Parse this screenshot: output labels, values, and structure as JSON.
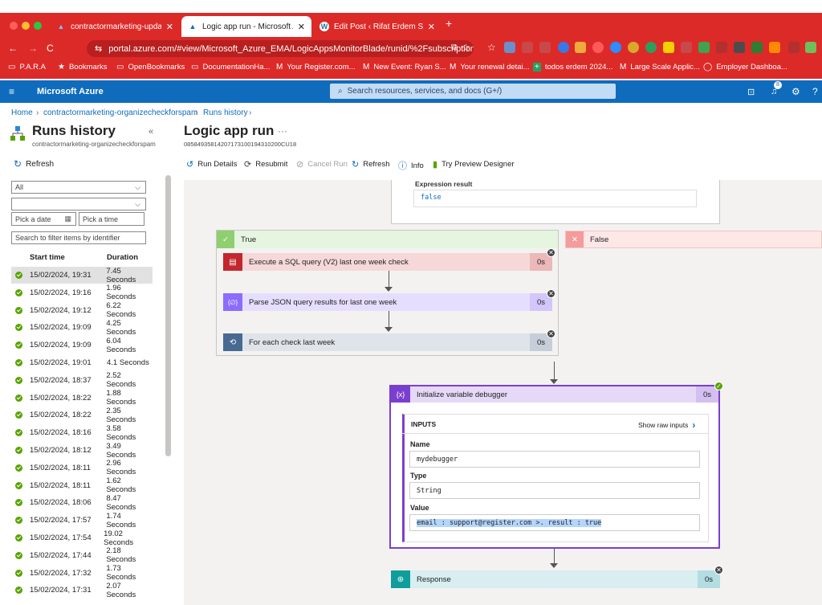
{
  "browser": {
    "tabs": [
      {
        "title": "contractormarketing-updated",
        "icon": "azure-icon"
      },
      {
        "title": "Logic app run - Microsoft Azu",
        "icon": "azure-icon"
      },
      {
        "title": "Edit Post ‹ Rifat Erdem Sahin",
        "icon": "wordpress-icon"
      }
    ],
    "url": "portal.azure.com/#view/Microsoft_Azure_EMA/LogicAppsMonitorBlade/runid/%2Fsubscriptions...",
    "bookmarks": [
      {
        "label": "P.A.R.A",
        "icon": "folder-icon"
      },
      {
        "label": "Bookmarks",
        "icon": "star-icon"
      },
      {
        "label": "OpenBookmarks",
        "icon": "folder-icon"
      },
      {
        "label": "DocumentationHa...",
        "icon": "folder-icon"
      },
      {
        "label": "Your Register.com...",
        "icon": "gmail-icon"
      },
      {
        "label": "New Event: Ryan S...",
        "icon": "gmail-icon"
      },
      {
        "label": "Your renewal detai...",
        "icon": "gmail-icon"
      },
      {
        "label": "todos erdem 2024...",
        "icon": "sheets-icon"
      },
      {
        "label": "Large Scale Applic...",
        "icon": "gmail-icon"
      },
      {
        "label": "Employer Dashboa...",
        "icon": "globe-icon"
      }
    ],
    "notification_count": "8"
  },
  "azure": {
    "brand": "Microsoft Azure",
    "search_placeholder": "Search resources, services, and docs (G+/)",
    "badge": "8"
  },
  "breadcrumb": [
    "Home",
    "contractormarketing-organizecheckforspam",
    "Runs history"
  ],
  "left_panel": {
    "title": "Runs history",
    "subtitle": "contractormarketing-organizecheckforspam",
    "refresh": "Refresh",
    "status_filter": "All",
    "second_filter": "",
    "date_placeholder": "Pick a date",
    "time_placeholder": "Pick a time",
    "search_placeholder": "Search to filter items by identifier",
    "col_start": "Start time",
    "col_duration": "Duration",
    "runs": [
      {
        "start": "15/02/2024, 19:31",
        "duration": "7.45 Seconds",
        "selected": true
      },
      {
        "start": "15/02/2024, 19:16",
        "duration": "1.96 Seconds"
      },
      {
        "start": "15/02/2024, 19:12",
        "duration": "6.22 Seconds"
      },
      {
        "start": "15/02/2024, 19:09",
        "duration": "4.25 Seconds"
      },
      {
        "start": "15/02/2024, 19:09",
        "duration": "6.04 Seconds"
      },
      {
        "start": "15/02/2024, 19:01",
        "duration": "4.1 Seconds"
      },
      {
        "start": "15/02/2024, 18:37",
        "duration": "2.52 Seconds"
      },
      {
        "start": "15/02/2024, 18:22",
        "duration": "1.88 Seconds"
      },
      {
        "start": "15/02/2024, 18:22",
        "duration": "2.35 Seconds"
      },
      {
        "start": "15/02/2024, 18:16",
        "duration": "3.58 Seconds"
      },
      {
        "start": "15/02/2024, 18:12",
        "duration": "3.49 Seconds"
      },
      {
        "start": "15/02/2024, 18:11",
        "duration": "2.96 Seconds"
      },
      {
        "start": "15/02/2024, 18:11",
        "duration": "1.62 Seconds"
      },
      {
        "start": "15/02/2024, 18:06",
        "duration": "8.47 Seconds"
      },
      {
        "start": "15/02/2024, 17:57",
        "duration": "1.74 Seconds"
      },
      {
        "start": "15/02/2024, 17:54",
        "duration": "19.02 Seconds"
      },
      {
        "start": "15/02/2024, 17:44",
        "duration": "2.18 Seconds"
      },
      {
        "start": "15/02/2024, 17:32",
        "duration": "1.73 Seconds"
      },
      {
        "start": "15/02/2024, 17:31",
        "duration": "2.07 Seconds"
      }
    ]
  },
  "main": {
    "title": "Logic app run",
    "run_id": "08584935814207173100194310200CU18",
    "toolbar": [
      {
        "label": "Run Details",
        "icon": "history-icon",
        "enabled": true
      },
      {
        "label": "Resubmit",
        "icon": "resubmit-icon",
        "enabled": true
      },
      {
        "label": "Cancel Run",
        "icon": "cancel-icon",
        "enabled": false
      },
      {
        "label": "Refresh",
        "icon": "refresh-icon",
        "enabled": true
      },
      {
        "label": "Info",
        "icon": "info-icon",
        "enabled": true
      },
      {
        "label": "Try Preview Designer",
        "icon": "bookmark-icon",
        "enabled": true
      }
    ],
    "condition": {
      "expression_label": "Expression result",
      "expression_value": "false"
    },
    "true_branch": "True",
    "false_branch": "False",
    "actions": [
      {
        "label": "Execute a SQL query (V2) last one week check",
        "duration": "0s",
        "color": "#c4262e"
      },
      {
        "label": "Parse JSON query results for last one week",
        "duration": "0s",
        "color": "#8c6cff"
      },
      {
        "label": "For each check last week",
        "duration": "0s",
        "color": "#486991"
      }
    ],
    "init_var": {
      "title": "Initialize variable debugger",
      "duration": "0s",
      "inputs_label": "INPUTS",
      "show_raw": "Show raw inputs",
      "name_label": "Name",
      "name_value": "mydebugger",
      "type_label": "Type",
      "type_value": "String",
      "value_label": "Value",
      "value_value": "email : support@register.com >. result : true"
    },
    "response": {
      "label": "Response",
      "duration": "0s"
    }
  }
}
